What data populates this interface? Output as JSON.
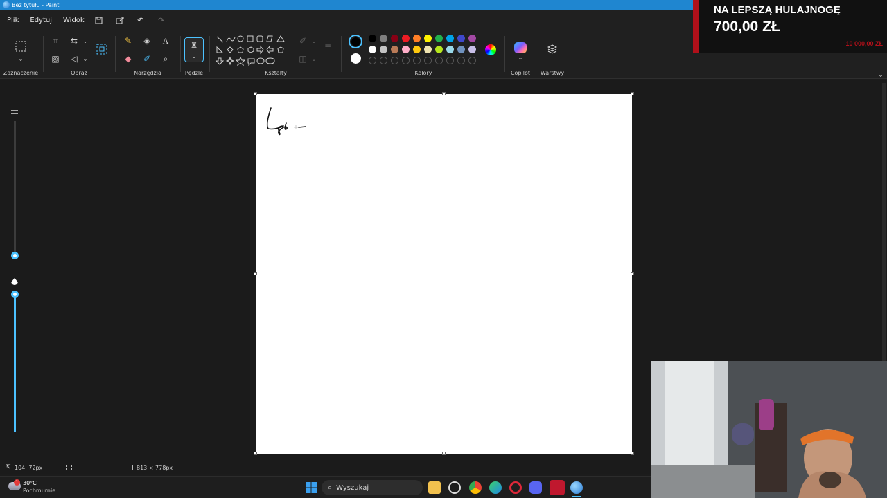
{
  "window": {
    "title": "Bez tytułu - Paint"
  },
  "menu": {
    "file": "Plik",
    "edit": "Edytuj",
    "view": "Widok"
  },
  "ribbon": {
    "groups": {
      "selection": "Zaznaczenie",
      "image": "Obraz",
      "tools": "Narzędzia",
      "brushes": "Pędzle",
      "shapes": "Kształty",
      "colors": "Kolory",
      "copilot": "Copilot",
      "layers": "Warstwy"
    },
    "palette_row1": [
      "#000000",
      "#7f7f7f",
      "#880015",
      "#ed1c24",
      "#ff7f27",
      "#fff200",
      "#22b14c",
      "#00a2e8",
      "#3f48cc",
      "#a349a4"
    ],
    "palette_row2": [
      "#ffffff",
      "#c3c3c3",
      "#b97a57",
      "#ffaec9",
      "#ffc90e",
      "#efe4b0",
      "#b5e61d",
      "#99d9ea",
      "#7092be",
      "#c8bfe7"
    ],
    "primary_color": "#000000",
    "secondary_color": "#ffffff"
  },
  "status": {
    "cursor_pos": "104, 72px",
    "canvas_size": "813 × 778px"
  },
  "taskbar": {
    "weather_temp": "30°C",
    "weather_desc": "Pochmurnie",
    "search_placeholder": "Wyszukaj",
    "weather_badge": "1"
  },
  "overlay": {
    "promo_line1": "NA LEPSZĄ HULAJNOGĘ",
    "promo_line2": "700,00 ZŁ",
    "promo_goal": "10 000,00 ZŁ"
  },
  "accent": "#4cc2ff"
}
